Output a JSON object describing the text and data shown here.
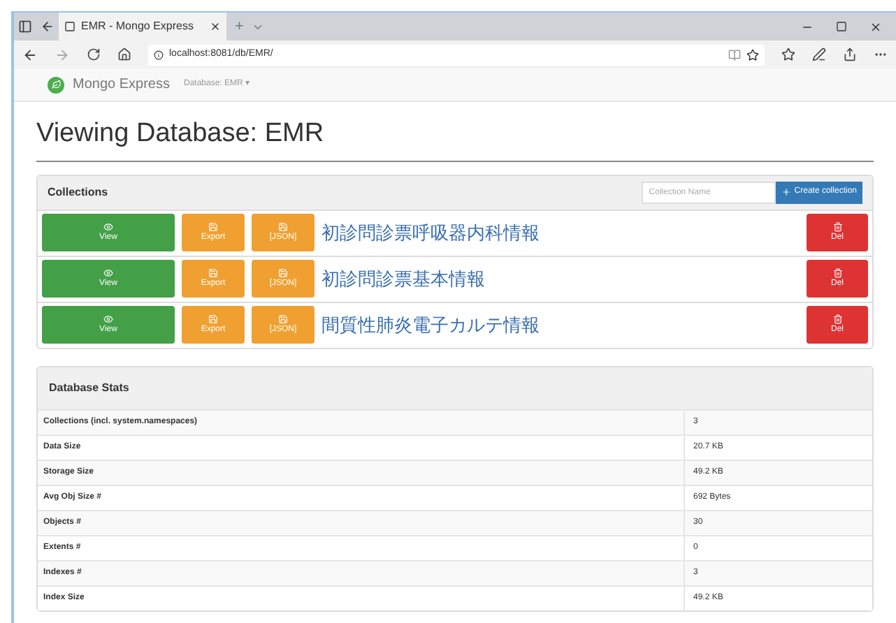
{
  "browser": {
    "tab_title": "EMR - Mongo Express",
    "new_tab": "+",
    "address": "localhost:8081/db/EMR/"
  },
  "navbar": {
    "brand": "Mongo Express",
    "database_menu": "Database: EMR",
    "caret": "▾"
  },
  "heading": "Viewing Database: EMR",
  "collections": {
    "title": "Collections",
    "name_field": {
      "placeholder": "Collection Name"
    },
    "create_button": "Create collection",
    "items": [
      {
        "name": "初診問診票呼吸器内科情報",
        "view": "View",
        "export": "Export",
        "json": "[JSON]",
        "delete": "Del"
      },
      {
        "name": "初診問診票基本情報",
        "view": "View",
        "export": "Export",
        "json": "[JSON]",
        "delete": "Del"
      },
      {
        "name": "間質性肺炎電子カルテ情報",
        "view": "View",
        "export": "Export",
        "json": "[JSON]",
        "delete": "Del"
      }
    ]
  },
  "stats": {
    "title": "Database Stats",
    "rows": [
      {
        "label": "Collections (incl. system.namespaces)",
        "value": "3"
      },
      {
        "label": "Data Size",
        "value": "20.7 KB"
      },
      {
        "label": "Storage Size",
        "value": "49.2 KB"
      },
      {
        "label": "Avg Obj Size #",
        "value": "692 Bytes"
      },
      {
        "label": "Objects #",
        "value": "30"
      },
      {
        "label": "Extents #",
        "value": "0"
      },
      {
        "label": "Indexes #",
        "value": "3"
      },
      {
        "label": "Index Size",
        "value": "49.2 KB"
      }
    ]
  }
}
